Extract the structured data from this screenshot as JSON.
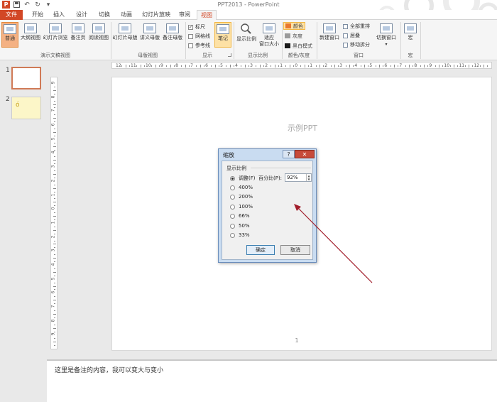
{
  "window": {
    "title": "PPT2013 - PowerPoint",
    "app_logo": "P"
  },
  "quick_access": {
    "save": "save-icon",
    "undo": "↶",
    "redo": "↻",
    "customize": "▾"
  },
  "tabs": [
    "文件",
    "开始",
    "插入",
    "设计",
    "切换",
    "动画",
    "幻灯片放映",
    "审阅",
    "视图"
  ],
  "active_tab": "视图",
  "ribbon": {
    "presentation_views": {
      "label": "演示文稿视图",
      "buttons": [
        "普通",
        "大纲视图",
        "幻灯片浏览",
        "备注页",
        "阅读视图"
      ]
    },
    "master_views": {
      "label": "母版视图",
      "buttons": [
        "幻灯片母版",
        "讲义母版",
        "备注母版"
      ]
    },
    "show": {
      "label": "显示",
      "checkboxes": [
        {
          "label": "标尺",
          "checked": true
        },
        {
          "label": "网格线",
          "checked": false
        },
        {
          "label": "参考线",
          "checked": false
        }
      ],
      "notes_button": "笔记"
    },
    "zoom": {
      "label": "显示比例",
      "zoom_button": "显示比例",
      "fit_button_line1": "适应",
      "fit_button_line2": "窗口大小"
    },
    "color": {
      "label": "颜色/灰度",
      "options": [
        {
          "label": "颜色",
          "swatch": "#e8772e"
        },
        {
          "label": "灰度",
          "swatch": "#9a9a9a"
        },
        {
          "label": "黑白模式",
          "swatch": "#1a1a1a"
        }
      ]
    },
    "window": {
      "label": "窗口",
      "new_window": "新建窗口",
      "arrange_all": "全部重排",
      "cascade": "层叠",
      "move_split": "移动拆分",
      "switch_windows": "切换窗口"
    },
    "macros": {
      "label": "宏",
      "button": "宏"
    }
  },
  "thumbnails": [
    {
      "number": "1",
      "selected": true
    },
    {
      "number": "2",
      "selected": false,
      "glyph": "ó"
    }
  ],
  "ruler": {
    "horizontal": [
      "12",
      "11",
      "10",
      "9",
      "8",
      "7",
      "6",
      "5",
      "4",
      "3",
      "2",
      "1",
      "0",
      "1",
      "2",
      "3",
      "4",
      "5",
      "6",
      "7",
      "8",
      "9",
      "10",
      "11",
      "12"
    ],
    "vertical": [
      "9",
      "8",
      "7",
      "6",
      "5",
      "4",
      "3",
      "2",
      "1",
      "0",
      "1",
      "2",
      "3",
      "4",
      "5",
      "6",
      "7",
      "8",
      "9"
    ]
  },
  "slide": {
    "title": "示例PPT",
    "page_number": "1"
  },
  "notes": {
    "text": "这里是备注的内容，我可以变大与变小"
  },
  "zoom_dialog": {
    "title": "缩放",
    "help": "?",
    "close": "✕",
    "group_label": "显示比例",
    "options": [
      {
        "label": "调整(F)",
        "checked": true
      },
      {
        "label": "400%",
        "checked": false
      },
      {
        "label": "200%",
        "checked": false
      },
      {
        "label": "100%",
        "checked": false
      },
      {
        "label": "66%",
        "checked": false
      },
      {
        "label": "50%",
        "checked": false
      },
      {
        "label": "33%",
        "checked": false
      }
    ],
    "percent_label": "百分比(P):",
    "percent_value": "92%",
    "ok": "确定",
    "cancel": "取消"
  },
  "colors": {
    "accent": "#d24726",
    "arrow": "#a11d2a",
    "dialog_frame": "#c9dcf1"
  }
}
